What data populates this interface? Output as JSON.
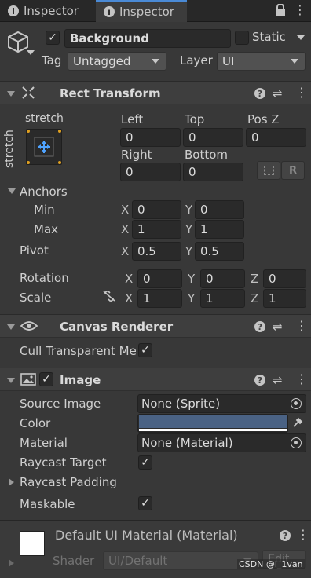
{
  "tabs": [
    {
      "label": "Inspector"
    },
    {
      "label": "Inspector"
    }
  ],
  "header": {
    "name": "Background",
    "static_label": "Static",
    "tag_label": "Tag",
    "tag_value": "Untagged",
    "layer_label": "Layer",
    "layer_value": "UI"
  },
  "rect": {
    "title": "Rect Transform",
    "anchor_preset_top": "stretch",
    "anchor_preset_side": "stretch",
    "left_label": "Left",
    "top_label": "Top",
    "posz_label": "Pos Z",
    "left": "0",
    "top": "0",
    "posz": "0",
    "right_label": "Right",
    "bottom_label": "Bottom",
    "right": "0",
    "bottom": "0",
    "r_button": "R",
    "anchors_label": "Anchors",
    "min_label": "Min",
    "max_label": "Max",
    "x_label": "X",
    "y_label": "Y",
    "z_label": "Z",
    "min_x": "0",
    "min_y": "0",
    "max_x": "1",
    "max_y": "1",
    "pivot_label": "Pivot",
    "pivot_x": "0.5",
    "pivot_y": "0.5",
    "rotation_label": "Rotation",
    "rot_x": "0",
    "rot_y": "0",
    "rot_z": "0",
    "scale_label": "Scale",
    "scale_x": "1",
    "scale_y": "1",
    "scale_z": "1"
  },
  "canvas": {
    "title": "Canvas Renderer",
    "cull_label": "Cull Transparent Mes"
  },
  "image": {
    "title": "Image",
    "source_label": "Source Image",
    "source_value": "None (Sprite)",
    "color_label": "Color",
    "color_value": "#4a6284",
    "material_label": "Material",
    "material_value": "None (Material)",
    "raycast_label": "Raycast Target",
    "padding_label": "Raycast Padding",
    "maskable_label": "Maskable"
  },
  "material": {
    "title": "Default UI Material (Material)",
    "shader_label": "Shader",
    "shader_value": "UI/Default",
    "edit_label": "Edit..."
  },
  "watermark": "CSDN @l_1van"
}
